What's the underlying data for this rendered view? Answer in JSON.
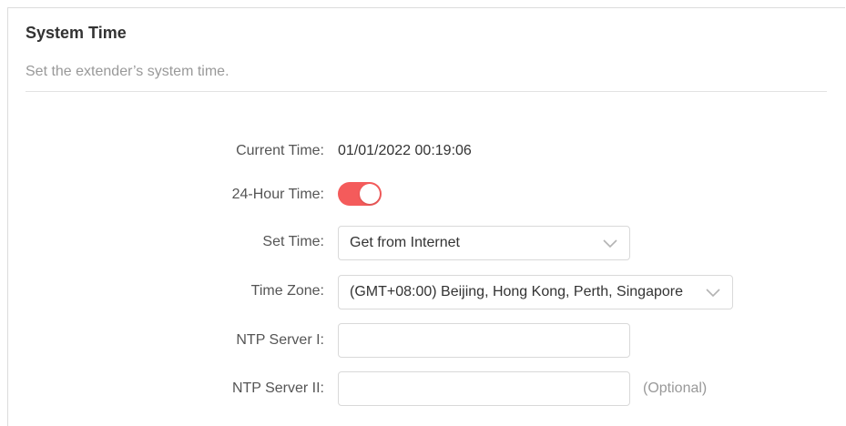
{
  "section": {
    "title": "System Time",
    "description": "Set the extender’s system time."
  },
  "form": {
    "current_time": {
      "label": "Current Time:",
      "value": "01/01/2022 00:19:06"
    },
    "hour_format": {
      "label": "24-Hour Time:",
      "enabled": true
    },
    "set_time": {
      "label": "Set Time:",
      "selected": "Get from Internet"
    },
    "time_zone": {
      "label": "Time Zone:",
      "selected": "(GMT+08:00) Beijing, Hong Kong, Perth, Singapore"
    },
    "ntp_server_1": {
      "label": "NTP Server I:",
      "value": ""
    },
    "ntp_server_2": {
      "label": "NTP Server II:",
      "value": "",
      "hint": "(Optional)"
    }
  },
  "colors": {
    "toggle_on": "#f45b5b",
    "title": "#333333",
    "muted": "#999999"
  },
  "icons": {
    "dropdown": "chevron-down-icon"
  }
}
